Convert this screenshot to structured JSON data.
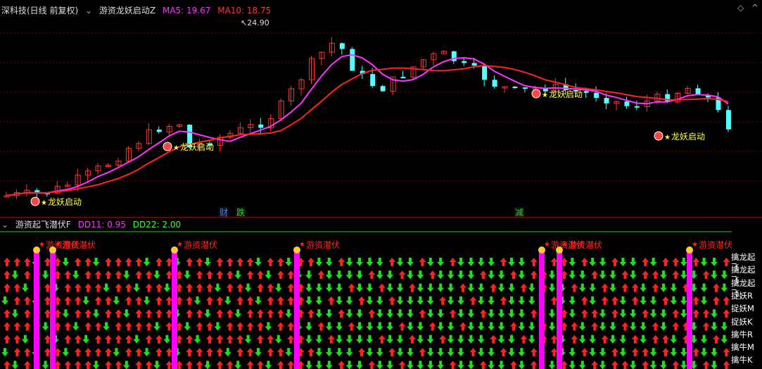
{
  "top_header": {
    "stock": "深科技(日线 前复权)",
    "indicator": "游资龙妖启动Z",
    "ma5_label": "MA5: 19.67",
    "ma10_label": "MA10: 18.75"
  },
  "main_chart": {
    "high_price_label": "24.90",
    "signal_label": "龙妖启动",
    "event_tags": [
      "财",
      "跌",
      "减"
    ],
    "colors": {
      "up": "#ff3333",
      "down": "#55ffff",
      "ma5": "#ff33ff",
      "ma10": "#ff2222",
      "signal": "#ffff44"
    }
  },
  "sub_header": {
    "indicator": "游资起飞潜伏F",
    "dd11_label": "DD11: 0.95",
    "dd22_label": "DD22: 2.00"
  },
  "sub_chart": {
    "signal_label": "游资潜伏",
    "row_labels": [
      "擒龙起飞",
      "擒龙起飞",
      "擒龙起飞",
      "捉妖R",
      "捉妖M",
      "捉妖K",
      "擒牛R",
      "擒牛M",
      "擒牛K"
    ],
    "colors": {
      "up_arrow": "#ff2222",
      "down_arrow": "#22dd22",
      "bar": "#ff00ff"
    }
  }
}
